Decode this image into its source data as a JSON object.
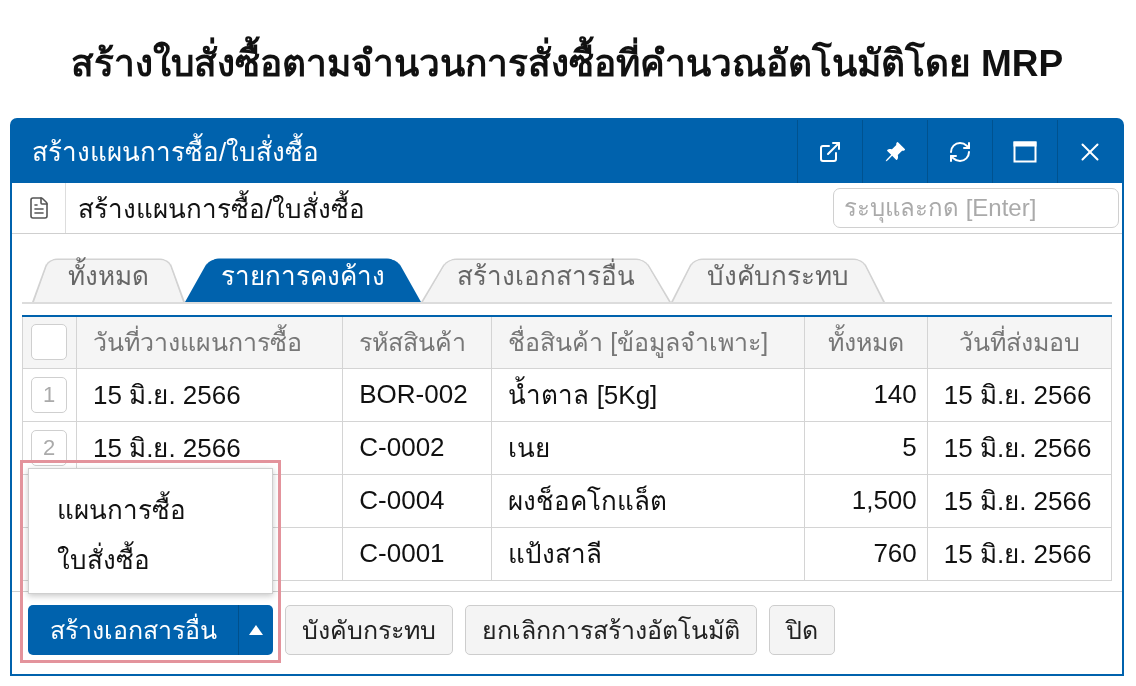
{
  "heading": "สร้างใบสั่งซื้อตามจำนวนการสั่งซื้อที่คำนวณอัตโนมัติโดย MRP",
  "window": {
    "title": "สร้างแผนการซื้อ/ใบสั่งซื้อ"
  },
  "toolbar": {
    "title": "สร้างแผนการซื้อ/ใบสั่งซื้อ",
    "search": {
      "placeholder": "ระบุและกด [Enter]"
    }
  },
  "tabs": [
    {
      "label": "ทั้งหมด",
      "selected": false
    },
    {
      "label": "รายการคงค้าง",
      "selected": true
    },
    {
      "label": "สร้างเอกสารอื่น",
      "selected": false
    },
    {
      "label": "บังคับกระทบ",
      "selected": false
    }
  ],
  "table": {
    "select_all": {
      "checked": false
    },
    "columns": [
      "วันที่วางแผนการซื้อ",
      "รหัสสินค้า",
      "ชื่อสินค้า [ข้อมูลจำเพาะ]",
      "ทั้งหมด",
      "วันที่ส่งมอบ"
    ],
    "rows": [
      {
        "number": "1",
        "plan_date": "15 มิ.ย. 2566",
        "product_code": "BOR-002",
        "product_name": "น้ำตาล [5Kg]",
        "total": "140",
        "delivery_date": "15 มิ.ย. 2566"
      },
      {
        "number": "2",
        "plan_date": "15 มิ.ย. 2566",
        "product_code": "C-0002",
        "product_name": "เนย",
        "total": "5",
        "delivery_date": "15 มิ.ย. 2566"
      },
      {
        "product_code": "C-0004",
        "product_name": "ผงช็อคโกแล็ต",
        "total": "1,500",
        "delivery_date": "15 มิ.ย. 2566"
      },
      {
        "product_code": "C-0001",
        "product_name": "แป้งสาลี",
        "total": "760",
        "delivery_date": "15 มิ.ย. 2566"
      }
    ]
  },
  "footer": {
    "buttons": [
      {
        "kind": "split",
        "label": "สร้างเอกสารอื่น"
      },
      {
        "kind": "plain",
        "label": "บังคับกระทบ"
      },
      {
        "kind": "plain",
        "label": "ยกเลิกการสร้างอัตโนมัติ"
      },
      {
        "kind": "plain",
        "label": "ปิด"
      }
    ]
  },
  "dropdown": {
    "open": true,
    "highlighted": true,
    "items": [
      "แผนการซื้อ",
      "ใบสั่งซื้อ"
    ]
  }
}
